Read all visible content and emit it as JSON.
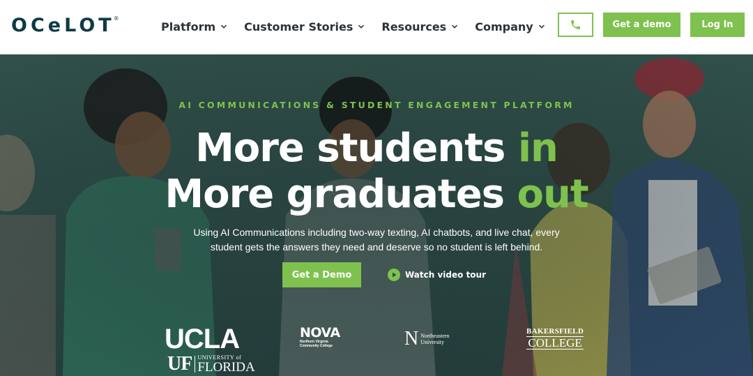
{
  "header": {
    "logo_text": "OCeLOT",
    "logo_reg": "®",
    "nav": [
      {
        "label": "Platform"
      },
      {
        "label": "Customer Stories"
      },
      {
        "label": "Resources"
      },
      {
        "label": "Company"
      }
    ],
    "phone_icon": "phone-icon",
    "demo_label": "Get a demo",
    "login_label": "Log In"
  },
  "hero": {
    "eyebrow": "AI COMMUNICATIONS & STUDENT ENGAGEMENT PLATFORM",
    "line1_a": "More students ",
    "line1_b": "in",
    "line2_a": "More graduates ",
    "line2_b": "out",
    "subtext": "Using AI Communications including two-way texting, AI chatbots, and live chat, every student gets the answers they need and deserve so no student is left behind.",
    "cta_label": "Get a Demo",
    "video_label": "Watch video tour",
    "video_icon": "play-circle-icon"
  },
  "logos": {
    "ucla": "UCLA",
    "uf_mark": "UF",
    "uf_top": "UNIVERSITY of",
    "uf_bottom": "FLORIDA",
    "nova": "NOVA",
    "nova_line1": "Northern Virginia",
    "nova_line2": "Community College",
    "ne_mark": "N",
    "ne_line1": "Northeastern",
    "ne_line2": "University",
    "bc_top": "BAKERSFIELD",
    "bc_bottom": "COLLEGE"
  },
  "colors": {
    "brand_dark": "#0d3b43",
    "accent_green": "#7fc14e",
    "nav_text": "#2b3338",
    "hero_bg": "#2d4a46"
  }
}
